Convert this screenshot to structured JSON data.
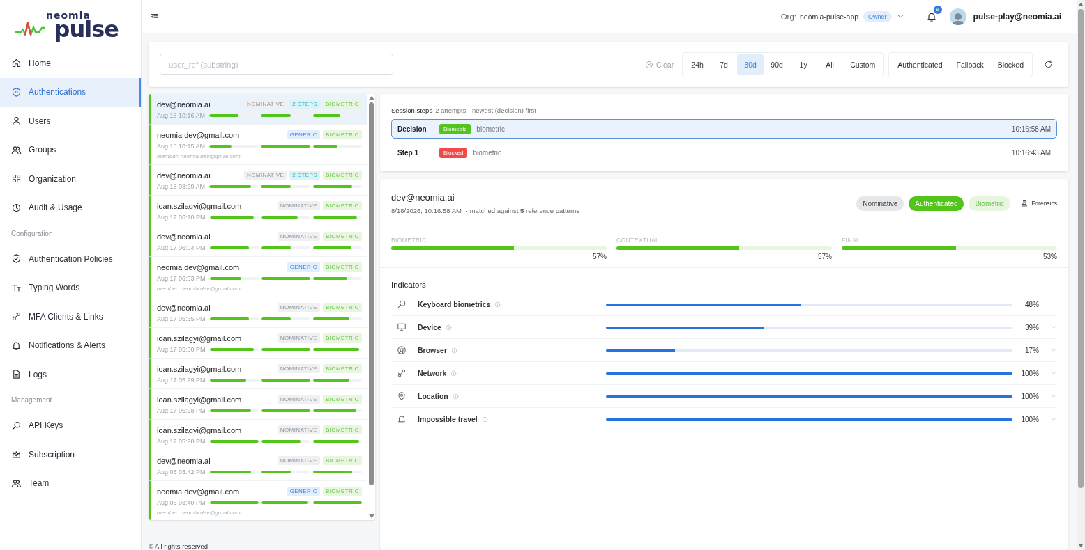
{
  "brand": {
    "top": "neomia",
    "bottom": "pulse"
  },
  "sidebar": {
    "items": [
      {
        "kind": "link",
        "label": "Home",
        "selected": false
      },
      {
        "kind": "link",
        "label": "Authentications",
        "selected": true
      },
      {
        "kind": "link",
        "label": "Users",
        "selected": false
      },
      {
        "kind": "link",
        "label": "Groups",
        "selected": false
      },
      {
        "kind": "link",
        "label": "Organization",
        "selected": false
      },
      {
        "kind": "link",
        "label": "Audit & Usage",
        "selected": false
      },
      {
        "kind": "section",
        "label": "Configuration"
      },
      {
        "kind": "link",
        "label": "Authentication Policies",
        "selected": false
      },
      {
        "kind": "link",
        "label": "Typing Words",
        "selected": false
      },
      {
        "kind": "link",
        "label": "MFA Clients & Links",
        "selected": false
      },
      {
        "kind": "link",
        "label": "Notifications & Alerts",
        "selected": false
      },
      {
        "kind": "link",
        "label": "Logs",
        "selected": false
      },
      {
        "kind": "section",
        "label": "Management"
      },
      {
        "kind": "link",
        "label": "API Keys",
        "selected": false
      },
      {
        "kind": "link",
        "label": "Subscription",
        "selected": false
      },
      {
        "kind": "link",
        "label": "Team",
        "selected": false
      }
    ]
  },
  "topbar": {
    "org_label": "Org:",
    "org_name": "neomia-pulse-app",
    "role": "Owner",
    "notifications": "9",
    "user": "pulse-play@neomia.ai"
  },
  "filters": {
    "placeholder": "user_ref (substring)",
    "clear": "Clear",
    "ranges": [
      {
        "label": "24h",
        "selected": false
      },
      {
        "label": "7d",
        "selected": false
      },
      {
        "label": "30d",
        "selected": true
      },
      {
        "label": "90d",
        "selected": false
      },
      {
        "label": "1y",
        "selected": false
      },
      {
        "label": "All",
        "selected": false
      },
      {
        "label": "Custom",
        "selected": false
      }
    ],
    "statuses": [
      {
        "label": "Authenticated"
      },
      {
        "label": "Fallback"
      },
      {
        "label": "Blocked"
      }
    ]
  },
  "sessions": [
    {
      "email": "dev@neomia.ai",
      "selected": true,
      "tags": [
        {
          "label": "NOMINATIVE",
          "kind": "nominative"
        },
        {
          "label": "2 STEPS",
          "kind": "steps"
        },
        {
          "label": "BIOMETRIC",
          "kind": "biometric"
        }
      ],
      "time": "Aug 18 10:16 AM",
      "bars": [
        {
          "level": 0.6
        },
        {
          "level": 0.6
        },
        {
          "level": 0.56
        }
      ]
    },
    {
      "email": "neomia.dev@gmail.com",
      "selected": false,
      "tags": [
        {
          "label": "GENERIC",
          "kind": "generic"
        },
        {
          "label": "BIOMETRIC",
          "kind": "biometric"
        }
      ],
      "time": "Aug 18 10:15 AM",
      "bars": [
        {
          "level": 0.45
        },
        {
          "level": 1
        },
        {
          "level": 0.5
        }
      ],
      "member": "member: neomia.dev@gmail.com"
    },
    {
      "email": "dev@neomia.ai",
      "selected": false,
      "tags": [
        {
          "label": "NOMINATIVE",
          "kind": "nominative"
        },
        {
          "label": "2 STEPS",
          "kind": "steps"
        },
        {
          "label": "BIOMETRIC",
          "kind": "biometric"
        }
      ],
      "time": "Aug 18 08:29 AM",
      "bars": [
        {
          "level": 0.85
        },
        {
          "level": 0.6
        },
        {
          "level": 0.8
        }
      ]
    },
    {
      "email": "ioan.szilagyi@gmail.com",
      "selected": false,
      "tags": [
        {
          "label": "NOMINATIVE",
          "kind": "nominative"
        },
        {
          "label": "BIOMETRIC",
          "kind": "biometric"
        }
      ],
      "time": "Aug 17 06:10 PM",
      "bars": [
        {
          "level": 0.9
        },
        {
          "level": 0.75
        },
        {
          "level": 0.9
        }
      ]
    },
    {
      "email": "dev@neomia.ai",
      "selected": false,
      "tags": [
        {
          "label": "NOMINATIVE",
          "kind": "nominative"
        },
        {
          "label": "BIOMETRIC",
          "kind": "biometric"
        }
      ],
      "time": "Aug 17 06:04 PM",
      "bars": [
        {
          "level": 0.8
        },
        {
          "level": 0.6
        },
        {
          "level": 0.78
        }
      ]
    },
    {
      "email": "neomia.dev@gmail.com",
      "selected": false,
      "tags": [
        {
          "label": "GENERIC",
          "kind": "generic"
        },
        {
          "label": "BIOMETRIC",
          "kind": "biometric"
        }
      ],
      "time": "Aug 17 06:03 PM",
      "bars": [
        {
          "level": 0.65
        },
        {
          "level": 1
        },
        {
          "level": 0.7
        }
      ],
      "member": "member: neomia.dev@gmail.com"
    },
    {
      "email": "dev@neomia.ai",
      "selected": false,
      "tags": [
        {
          "label": "NOMINATIVE",
          "kind": "nominative"
        },
        {
          "label": "BIOMETRIC",
          "kind": "biometric"
        }
      ],
      "time": "Aug 17 05:35 PM",
      "bars": [
        {
          "level": 0.8
        },
        {
          "level": 0.6
        },
        {
          "level": 0.75
        }
      ]
    },
    {
      "email": "ioan.szilagyi@gmail.com",
      "selected": false,
      "tags": [
        {
          "label": "NOMINATIVE",
          "kind": "nominative"
        },
        {
          "label": "BIOMETRIC",
          "kind": "biometric"
        }
      ],
      "time": "Aug 17 05:30 PM",
      "bars": [
        {
          "level": 0.9
        },
        {
          "level": 1
        },
        {
          "level": 0.95
        }
      ]
    },
    {
      "email": "ioan.szilagyi@gmail.com",
      "selected": false,
      "tags": [
        {
          "label": "NOMINATIVE",
          "kind": "nominative"
        },
        {
          "label": "BIOMETRIC",
          "kind": "biometric"
        }
      ],
      "time": "Aug 17 05:29 PM",
      "bars": [
        {
          "level": 0.75
        },
        {
          "level": 1
        },
        {
          "level": 0.75
        }
      ]
    },
    {
      "email": "ioan.szilagyi@gmail.com",
      "selected": false,
      "tags": [
        {
          "label": "NOMINATIVE",
          "kind": "nominative"
        },
        {
          "label": "BIOMETRIC",
          "kind": "biometric"
        }
      ],
      "time": "Aug 17 05:28 PM",
      "bars": [
        {
          "level": 0.85
        },
        {
          "level": 1
        },
        {
          "level": 0.88
        }
      ]
    },
    {
      "email": "ioan.szilagyi@gmail.com",
      "selected": false,
      "tags": [
        {
          "label": "NOMINATIVE",
          "kind": "nominative"
        },
        {
          "label": "BIOMETRIC",
          "kind": "biometric"
        }
      ],
      "time": "Aug 17 05:28 PM",
      "bars": [
        {
          "level": 1
        },
        {
          "level": 0.8
        },
        {
          "level": 0.95
        }
      ]
    },
    {
      "email": "dev@neomia.ai",
      "selected": false,
      "tags": [
        {
          "label": "NOMINATIVE",
          "kind": "nominative"
        },
        {
          "label": "BIOMETRIC",
          "kind": "biometric"
        }
      ],
      "time": "Aug 06 03:42 PM",
      "bars": [
        {
          "level": 0.85
        },
        {
          "level": 0.6
        },
        {
          "level": 0.8
        }
      ]
    },
    {
      "email": "neomia.dev@gmail.com",
      "selected": false,
      "tags": [
        {
          "label": "GENERIC",
          "kind": "generic"
        },
        {
          "label": "BIOMETRIC",
          "kind": "biometric"
        }
      ],
      "time": "Aug 06 03:40 PM",
      "bars": [
        {
          "level": 1
        },
        {
          "level": 0.95
        },
        {
          "level": 1
        }
      ],
      "member": "member: neomia.dev@gmail.com"
    }
  ],
  "session_steps": {
    "title": "Session steps",
    "subtitle": "2 attempts · newest (decision) first",
    "steps": [
      {
        "name": "Decision",
        "status": {
          "label": "Biometric",
          "kind": "success"
        },
        "method": "biometric",
        "time": "10:16:58 AM",
        "selected": true
      },
      {
        "name": "Step 1",
        "status": {
          "label": "Blocked",
          "kind": "blocked"
        },
        "method": "biometric",
        "time": "10:16:43 AM",
        "selected": false
      }
    ]
  },
  "detail": {
    "email": "dev@neomia.ai",
    "timestamp": "8/18/2026, 10:16:58 AM",
    "matched": "· matched against **5** reference patterns",
    "badges": [
      {
        "label": "Nominative",
        "kind": "neutral"
      },
      {
        "label": "Authenticated",
        "kind": "success"
      },
      {
        "label": "Biometric",
        "kind": "soft"
      }
    ],
    "forensics": "Forensics",
    "scores": [
      {
        "label": "BIOMETRIC",
        "level": 0.57,
        "value": "57%"
      },
      {
        "label": "CONTEXTUAL",
        "level": 0.57,
        "value": "57%"
      },
      {
        "label": "FINAL",
        "level": 0.53,
        "value": "53%"
      }
    ],
    "indicators": {
      "title": "Indicators",
      "items": [
        {
          "label": "Keyboard biometrics",
          "level": 0.48,
          "value": "48%",
          "expandable": false
        },
        {
          "label": "Device",
          "level": 0.39,
          "value": "39%",
          "expandable": true
        },
        {
          "label": "Browser",
          "level": 0.17,
          "value": "17%",
          "expandable": true
        },
        {
          "label": "Network",
          "level": 1,
          "value": "100%",
          "expandable": true
        },
        {
          "label": "Location",
          "level": 1,
          "value": "100%",
          "expandable": true
        },
        {
          "label": "Impossible travel",
          "level": 1,
          "value": "100%",
          "expandable": true
        }
      ]
    }
  },
  "footer": "© All rights reserved"
}
